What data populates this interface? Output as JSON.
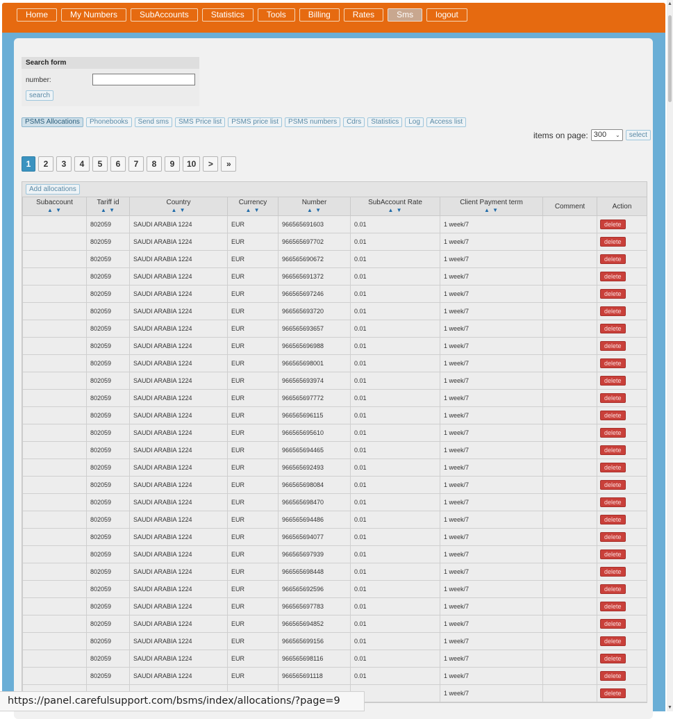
{
  "top_nav": [
    {
      "label": "Home",
      "active": false
    },
    {
      "label": "My Numbers",
      "active": false
    },
    {
      "label": "SubAccounts",
      "active": false
    },
    {
      "label": "Statistics",
      "active": false
    },
    {
      "label": "Tools",
      "active": false
    },
    {
      "label": "Billing",
      "active": false
    },
    {
      "label": "Rates",
      "active": false
    },
    {
      "label": "Sms",
      "active": true
    },
    {
      "label": "logout",
      "active": false
    }
  ],
  "search_form": {
    "title": "Search form",
    "number_label": "number:",
    "number_value": "",
    "search_button": "search"
  },
  "sub_tabs": [
    {
      "label": "PSMS Allocations",
      "active": true
    },
    {
      "label": "Phonebooks",
      "active": false
    },
    {
      "label": "Send sms",
      "active": false
    },
    {
      "label": "SMS Price list",
      "active": false
    },
    {
      "label": "PSMS price list",
      "active": false
    },
    {
      "label": "PSMS numbers",
      "active": false
    },
    {
      "label": "Cdrs",
      "active": false
    },
    {
      "label": "Statistics",
      "active": false
    },
    {
      "label": "Log",
      "active": false
    },
    {
      "label": "Access list",
      "active": false
    }
  ],
  "items_on_page": {
    "label": "items on page:",
    "selected": "300",
    "select_button": "select"
  },
  "pagination": {
    "current": "1",
    "pages": [
      "1",
      "2",
      "3",
      "4",
      "5",
      "6",
      "7",
      "8",
      "9",
      "10"
    ],
    "next": ">",
    "last": "»"
  },
  "table": {
    "add_button": "Add allocations",
    "sort_glyphs": "▲ ▼",
    "columns": [
      {
        "label": "Subaccount",
        "sortable": true
      },
      {
        "label": "Tariff id",
        "sortable": true
      },
      {
        "label": "Country",
        "sortable": true
      },
      {
        "label": "Currency",
        "sortable": true
      },
      {
        "label": "Number",
        "sortable": true
      },
      {
        "label": "SubAccount Rate",
        "sortable": true
      },
      {
        "label": "Client Payment term",
        "sortable": true
      },
      {
        "label": "Comment",
        "sortable": false
      },
      {
        "label": "Action",
        "sortable": false
      }
    ],
    "delete_label": "delete",
    "rows": [
      {
        "subaccount": "",
        "tariff_id": "802059",
        "country": "SAUDI ARABIA 1224",
        "currency": "EUR",
        "number": "966565691603",
        "rate": "0.01",
        "payment_term": "1 week/7",
        "comment": ""
      },
      {
        "subaccount": "",
        "tariff_id": "802059",
        "country": "SAUDI ARABIA 1224",
        "currency": "EUR",
        "number": "966565697702",
        "rate": "0.01",
        "payment_term": "1 week/7",
        "comment": ""
      },
      {
        "subaccount": "",
        "tariff_id": "802059",
        "country": "SAUDI ARABIA 1224",
        "currency": "EUR",
        "number": "966565690672",
        "rate": "0.01",
        "payment_term": "1 week/7",
        "comment": ""
      },
      {
        "subaccount": "",
        "tariff_id": "802059",
        "country": "SAUDI ARABIA 1224",
        "currency": "EUR",
        "number": "966565691372",
        "rate": "0.01",
        "payment_term": "1 week/7",
        "comment": ""
      },
      {
        "subaccount": "",
        "tariff_id": "802059",
        "country": "SAUDI ARABIA 1224",
        "currency": "EUR",
        "number": "966565697246",
        "rate": "0.01",
        "payment_term": "1 week/7",
        "comment": ""
      },
      {
        "subaccount": "",
        "tariff_id": "802059",
        "country": "SAUDI ARABIA 1224",
        "currency": "EUR",
        "number": "966565693720",
        "rate": "0.01",
        "payment_term": "1 week/7",
        "comment": ""
      },
      {
        "subaccount": "",
        "tariff_id": "802059",
        "country": "SAUDI ARABIA 1224",
        "currency": "EUR",
        "number": "966565693657",
        "rate": "0.01",
        "payment_term": "1 week/7",
        "comment": ""
      },
      {
        "subaccount": "",
        "tariff_id": "802059",
        "country": "SAUDI ARABIA 1224",
        "currency": "EUR",
        "number": "966565696988",
        "rate": "0.01",
        "payment_term": "1 week/7",
        "comment": ""
      },
      {
        "subaccount": "",
        "tariff_id": "802059",
        "country": "SAUDI ARABIA 1224",
        "currency": "EUR",
        "number": "966565698001",
        "rate": "0.01",
        "payment_term": "1 week/7",
        "comment": ""
      },
      {
        "subaccount": "",
        "tariff_id": "802059",
        "country": "SAUDI ARABIA 1224",
        "currency": "EUR",
        "number": "966565693974",
        "rate": "0.01",
        "payment_term": "1 week/7",
        "comment": ""
      },
      {
        "subaccount": "",
        "tariff_id": "802059",
        "country": "SAUDI ARABIA 1224",
        "currency": "EUR",
        "number": "966565697772",
        "rate": "0.01",
        "payment_term": "1 week/7",
        "comment": ""
      },
      {
        "subaccount": "",
        "tariff_id": "802059",
        "country": "SAUDI ARABIA 1224",
        "currency": "EUR",
        "number": "966565696115",
        "rate": "0.01",
        "payment_term": "1 week/7",
        "comment": ""
      },
      {
        "subaccount": "",
        "tariff_id": "802059",
        "country": "SAUDI ARABIA 1224",
        "currency": "EUR",
        "number": "966565695610",
        "rate": "0.01",
        "payment_term": "1 week/7",
        "comment": ""
      },
      {
        "subaccount": "",
        "tariff_id": "802059",
        "country": "SAUDI ARABIA 1224",
        "currency": "EUR",
        "number": "966565694465",
        "rate": "0.01",
        "payment_term": "1 week/7",
        "comment": ""
      },
      {
        "subaccount": "",
        "tariff_id": "802059",
        "country": "SAUDI ARABIA 1224",
        "currency": "EUR",
        "number": "966565692493",
        "rate": "0.01",
        "payment_term": "1 week/7",
        "comment": ""
      },
      {
        "subaccount": "",
        "tariff_id": "802059",
        "country": "SAUDI ARABIA 1224",
        "currency": "EUR",
        "number": "966565698084",
        "rate": "0.01",
        "payment_term": "1 week/7",
        "comment": ""
      },
      {
        "subaccount": "",
        "tariff_id": "802059",
        "country": "SAUDI ARABIA 1224",
        "currency": "EUR",
        "number": "966565698470",
        "rate": "0.01",
        "payment_term": "1 week/7",
        "comment": ""
      },
      {
        "subaccount": "",
        "tariff_id": "802059",
        "country": "SAUDI ARABIA 1224",
        "currency": "EUR",
        "number": "966565694486",
        "rate": "0.01",
        "payment_term": "1 week/7",
        "comment": ""
      },
      {
        "subaccount": "",
        "tariff_id": "802059",
        "country": "SAUDI ARABIA 1224",
        "currency": "EUR",
        "number": "966565694077",
        "rate": "0.01",
        "payment_term": "1 week/7",
        "comment": ""
      },
      {
        "subaccount": "",
        "tariff_id": "802059",
        "country": "SAUDI ARABIA 1224",
        "currency": "EUR",
        "number": "966565697939",
        "rate": "0.01",
        "payment_term": "1 week/7",
        "comment": ""
      },
      {
        "subaccount": "",
        "tariff_id": "802059",
        "country": "SAUDI ARABIA 1224",
        "currency": "EUR",
        "number": "966565698448",
        "rate": "0.01",
        "payment_term": "1 week/7",
        "comment": ""
      },
      {
        "subaccount": "",
        "tariff_id": "802059",
        "country": "SAUDI ARABIA 1224",
        "currency": "EUR",
        "number": "966565692596",
        "rate": "0.01",
        "payment_term": "1 week/7",
        "comment": ""
      },
      {
        "subaccount": "",
        "tariff_id": "802059",
        "country": "SAUDI ARABIA 1224",
        "currency": "EUR",
        "number": "966565697783",
        "rate": "0.01",
        "payment_term": "1 week/7",
        "comment": ""
      },
      {
        "subaccount": "",
        "tariff_id": "802059",
        "country": "SAUDI ARABIA 1224",
        "currency": "EUR",
        "number": "966565694852",
        "rate": "0.01",
        "payment_term": "1 week/7",
        "comment": ""
      },
      {
        "subaccount": "",
        "tariff_id": "802059",
        "country": "SAUDI ARABIA 1224",
        "currency": "EUR",
        "number": "966565699156",
        "rate": "0.01",
        "payment_term": "1 week/7",
        "comment": ""
      },
      {
        "subaccount": "",
        "tariff_id": "802059",
        "country": "SAUDI ARABIA 1224",
        "currency": "EUR",
        "number": "966565698116",
        "rate": "0.01",
        "payment_term": "1 week/7",
        "comment": ""
      },
      {
        "subaccount": "",
        "tariff_id": "802059",
        "country": "SAUDI ARABIA 1224",
        "currency": "EUR",
        "number": "966565691118",
        "rate": "0.01",
        "payment_term": "1 week/7",
        "comment": ""
      },
      {
        "subaccount": "",
        "tariff_id": "",
        "country": "",
        "currency": "",
        "number": "",
        "rate": "",
        "payment_term": "1 week/7",
        "comment": ""
      }
    ]
  },
  "status_bar": {
    "url": "https://panel.carefulsupport.com/bsms/index/allocations/?page=9"
  },
  "colors": {
    "header_orange": "#e66a10",
    "frame_blue": "#6aaed6",
    "delete_red": "#c9403a",
    "active_page_blue": "#3b93c0"
  }
}
